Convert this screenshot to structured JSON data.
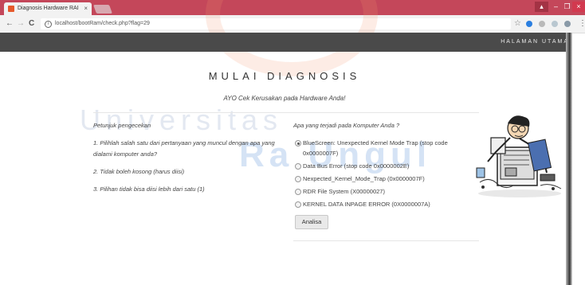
{
  "browser": {
    "tab_title": "Diagnosis Hardware RAI",
    "tab_close": "×",
    "url": "localhost/bootRam/check.php?flag=29",
    "win_min": "–",
    "win_max": "❐",
    "win_close": "×",
    "back": "←",
    "forward": "→",
    "reload": "C",
    "info": "i",
    "star": "☆",
    "menu": "⋮",
    "ext_colors": [
      "#2b7fe0",
      "#b9b9b9",
      "#b9c7d0",
      "#8a9aa8"
    ]
  },
  "nav": {
    "home_link": "HALAMAN UTAMA"
  },
  "watermark": {
    "line1": "Universitas",
    "line2": "Ra Ungul"
  },
  "page": {
    "title": "MULAI DIAGNOSIS",
    "subtitle": "AYO Cek Kerusakan pada Hardware Anda!"
  },
  "instructions": {
    "heading": "Petunjuk pengecekan",
    "items": [
      "1. Pilihlah salah satu dari pertanyaan yang muncul dengan apa yang dialami komputer anda?",
      "2. Tidak boleh kosong (harus diisi)",
      "3. Pilihan tidak bisa diisi lebih dari satu (1)"
    ]
  },
  "question": {
    "heading": "Apa yang terjadi pada Komputer Anda ?",
    "options": [
      {
        "label": "BlueScreen: Unexpected Kernel Mode Trap (stop code 0x0000007F)",
        "checked": true
      },
      {
        "label": "Data Bus Error (stop code 0x0000002E)",
        "checked": false
      },
      {
        "label": "Nexpected_Kernel_Mode_Trap (0x0000007F)",
        "checked": false
      },
      {
        "label": "RDR File System (X00000027)",
        "checked": false
      },
      {
        "label": "KERNEL DATA INPAGE ERROR (0X0000007A)",
        "checked": false
      }
    ],
    "submit_label": "Analisa"
  },
  "colors": {
    "tabstrip": "#c4475a",
    "navband": "#4a4a4a"
  }
}
